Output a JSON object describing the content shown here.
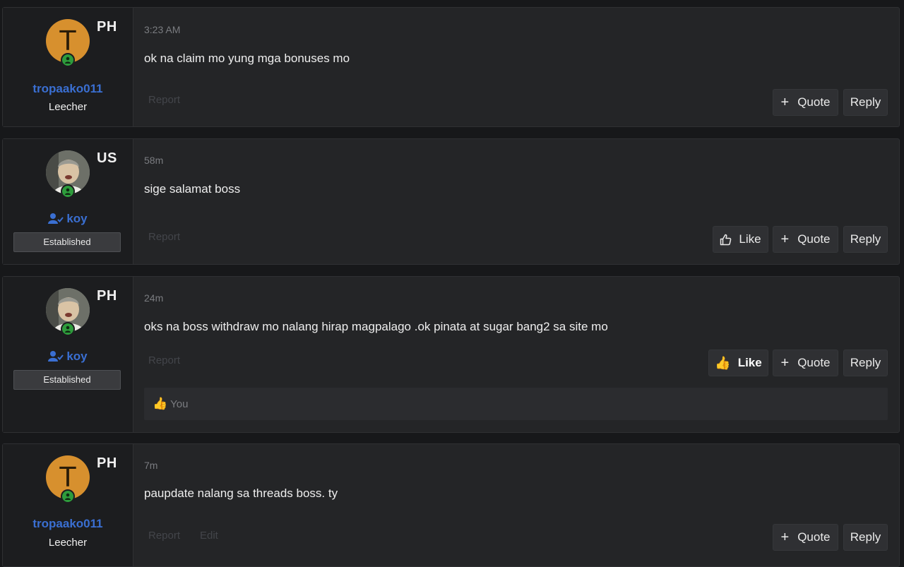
{
  "posts": [
    {
      "avatar_letter": "T",
      "flag": "PH",
      "username": "tropaako011",
      "usertitle": "Leecher",
      "time": "3:23 AM",
      "message": "ok na claim mo yung mga bonuses mo",
      "report": "Report",
      "quote": "Quote",
      "reply": "Reply"
    },
    {
      "flag": "US",
      "username": "koy",
      "banner": "Established",
      "time": "58m",
      "message": "sige salamat boss",
      "report": "Report",
      "like": "Like",
      "quote": "Quote",
      "reply": "Reply"
    },
    {
      "flag": "PH",
      "username": "koy",
      "banner": "Established",
      "time": "24m",
      "message": "oks na boss withdraw mo nalang hirap magpalago .ok pinata at sugar bang2 sa site mo",
      "report": "Report",
      "like": "Like",
      "quote": "Quote",
      "reply": "Reply",
      "likes_text": "You",
      "like_emoji": "👍"
    },
    {
      "avatar_letter": "T",
      "flag": "PH",
      "username": "tropaako011",
      "usertitle": "Leecher",
      "time": "7m",
      "message": "paupdate nalang sa threads boss. ty",
      "report": "Report",
      "edit": "Edit",
      "quote": "Quote",
      "reply": "Reply"
    }
  ],
  "colors": {
    "background": "#17181a",
    "post_bg": "#242527",
    "user_cell_bg": "#1c1d1f",
    "username": "#3a6fd2",
    "online_dot": "#2e9c3c",
    "avatar_letter_bg": "#d7902e"
  }
}
